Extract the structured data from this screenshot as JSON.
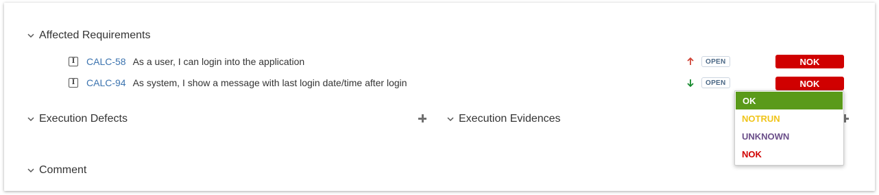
{
  "sections": {
    "affected_requirements": {
      "title": "Affected Requirements"
    },
    "execution_defects": {
      "title": "Execution Defects"
    },
    "execution_evidences": {
      "title": "Execution Evidences"
    },
    "comment": {
      "title": "Comment"
    }
  },
  "requirements": [
    {
      "type_icon": "I",
      "key": "CALC-58",
      "summary": "As a user, I can login into the application",
      "priority_icon": "arrow-up-icon",
      "priority_color": "#d04437",
      "status": "OPEN",
      "result": "NOK"
    },
    {
      "type_icon": "I",
      "key": "CALC-94",
      "summary": "As system, I show a message with last login date/time after login",
      "priority_icon": "arrow-down-icon",
      "priority_color": "#14892c",
      "status": "OPEN",
      "result": "NOK"
    }
  ],
  "result_dropdown": {
    "options": [
      {
        "label": "OK",
        "color": "#ffffff",
        "background": "#5a9a1a",
        "selected": true
      },
      {
        "label": "NOTRUN",
        "color": "#f0c419"
      },
      {
        "label": "UNKNOWN",
        "color": "#6b4f8a"
      },
      {
        "label": "NOK",
        "color": "#d00000"
      }
    ]
  },
  "colors": {
    "link": "#3b73af",
    "nok": "#d00000",
    "lozenge_text": "#4a6785"
  }
}
